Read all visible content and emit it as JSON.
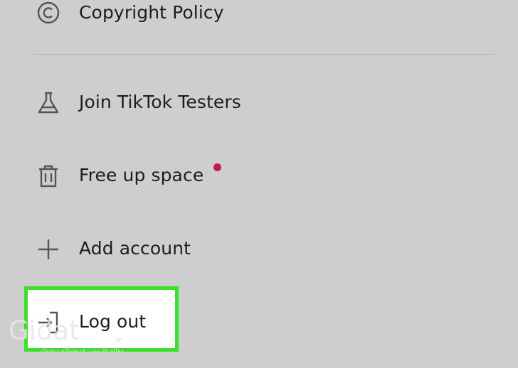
{
  "menu": {
    "items": [
      {
        "label": "Copyright Policy",
        "icon": "copyright-icon"
      },
      {
        "label": "Join TikTok Testers",
        "icon": "flask-icon"
      },
      {
        "label": "Free up space",
        "icon": "trash-icon",
        "badge_color": "#c51a4a"
      },
      {
        "label": "Add account",
        "icon": "plus-icon"
      },
      {
        "label": "Log out",
        "icon": "logout-icon"
      }
    ]
  },
  "highlight_color": "#3be02a",
  "watermark": {
    "word": "Gidat",
    "suffix": ".ir",
    "subtitle": "مقاله فارسی، فروشگاه دیجیتال"
  }
}
